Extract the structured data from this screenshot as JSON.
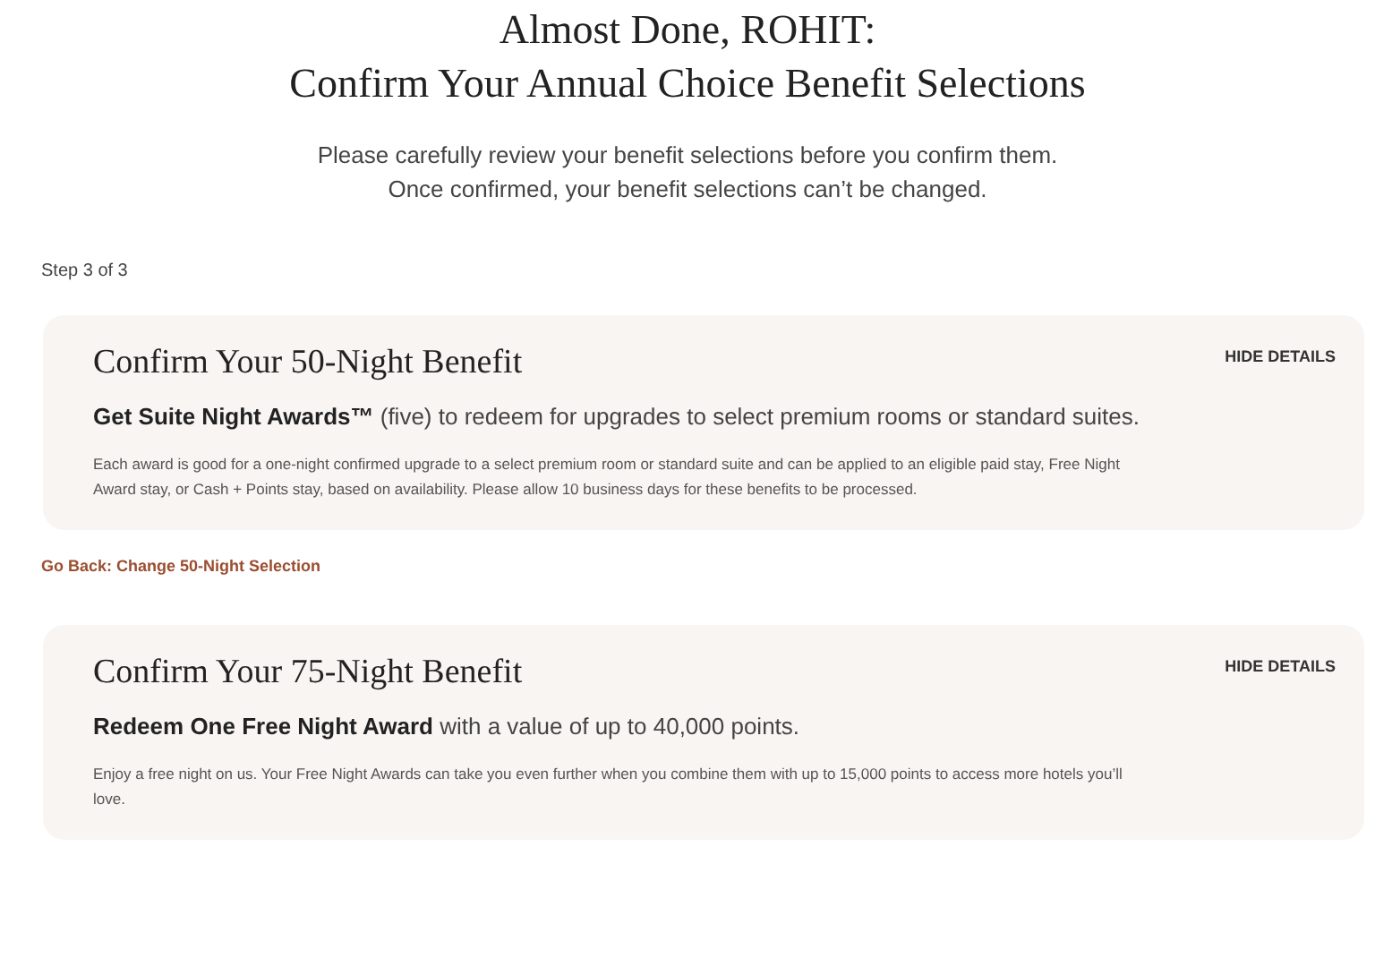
{
  "header": {
    "title_lines": [
      "Almost Done, ROHIT:",
      "Confirm Your Annual Choice Benefit Selections"
    ],
    "intro_lines": [
      "Please carefully review your benefit selections before you confirm them.",
      "Once confirmed, your benefit selections can’t be changed."
    ]
  },
  "step": "Step 3 of 3",
  "cards": [
    {
      "title": "Confirm Your 50-Night Benefit",
      "toggle": "HIDE DETAILS",
      "summary": "**Get Suite Night Awards™** (five) to redeem for upgrades to select premium rooms or standard suites.",
      "details": "Each award is good for a one-night confirmed upgrade to a select premium room or standard suite and can be applied to an eligible paid stay, Free Night Award stay, or Cash + Points stay, based on availability. Please allow 10 business days for these benefits to be processed.",
      "back_link": "Go Back: Change 50-Night Selection"
    },
    {
      "title": "Confirm Your 75-Night Benefit",
      "toggle": "HIDE DETAILS",
      "summary": "**Redeem One Free Night Award** with a value of up to 40,000 points.",
      "details": "Enjoy a free night on us. Your Free Night Awards can take you even further when you combine them with up to 15,000 points to access more hotels you’ll love."
    }
  ]
}
